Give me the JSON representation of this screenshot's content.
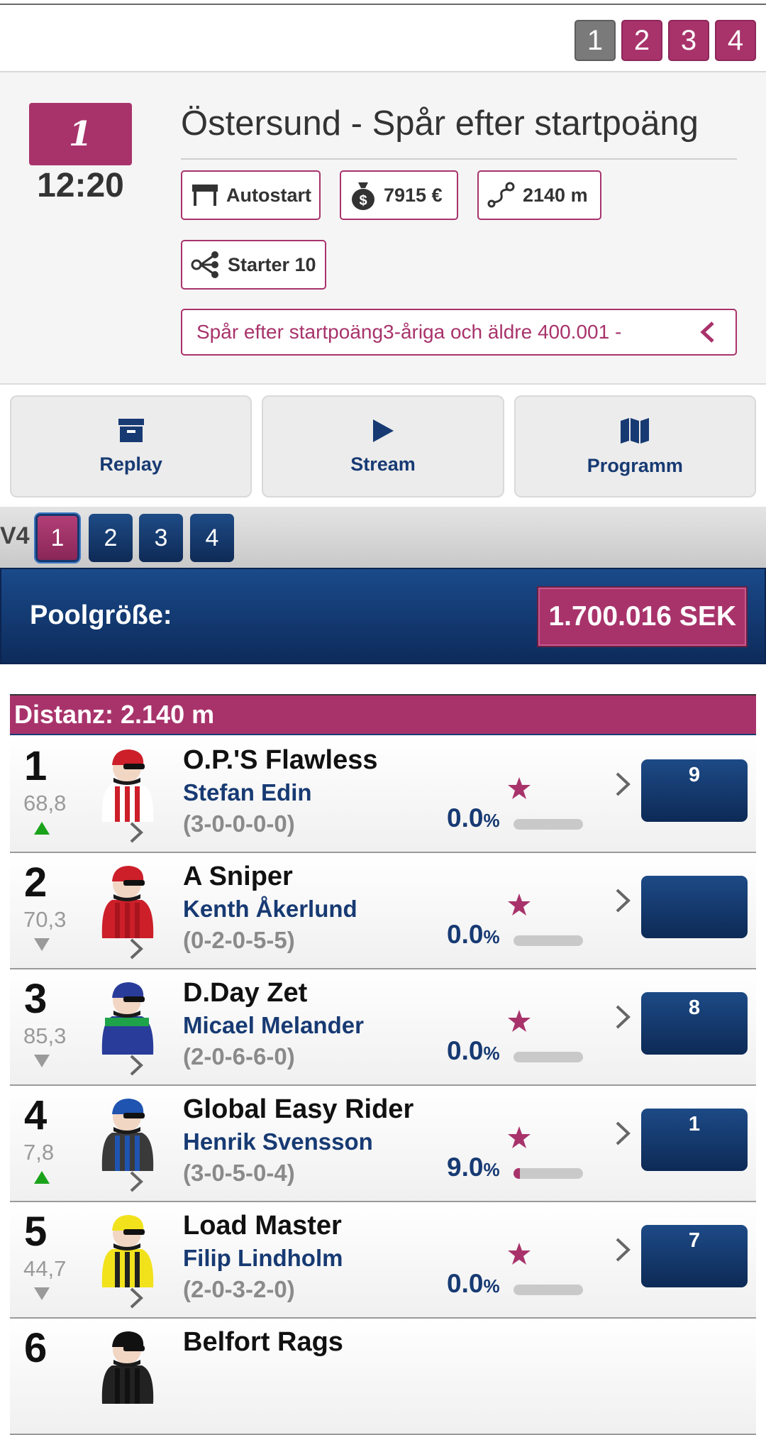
{
  "race_selector": {
    "tabs": [
      "1",
      "2",
      "3",
      "4"
    ],
    "active": "1"
  },
  "race": {
    "number": "1",
    "time": "12:20",
    "title": "Östersund - Spår efter startpoäng",
    "start_type": "Autostart",
    "prize": "7915 €",
    "distance": "2140 m",
    "starters": "Starter 10",
    "description": "Spår efter startpoäng3-åriga och äldre 400.001 -"
  },
  "actions": {
    "replay": "Replay",
    "stream": "Stream",
    "program": "Programm"
  },
  "game": {
    "label": "V4",
    "legs": [
      "1",
      "2",
      "3",
      "4"
    ],
    "active_leg": "1"
  },
  "pool": {
    "label": "Poolgröße:",
    "value": "1.700.016 SEK"
  },
  "distance_header": "Distanz: 2.140 m",
  "colors": {
    "accent": "#a8336b",
    "navy": "#0d2b5b",
    "up": "#1aa31a",
    "down": "#9a9a9a"
  },
  "runners": [
    {
      "num": "1",
      "rating": "68,8",
      "trend": "up",
      "name": "O.P.'S Flawless",
      "driver": "Stefan Edin",
      "record": "(3-0-0-0-0)",
      "pct_value": "0.0",
      "pct_unit": "%",
      "pct": 0.0,
      "slot": "9",
      "silk": "red-white-stripes"
    },
    {
      "num": "2",
      "rating": "70,3",
      "trend": "down",
      "name": "A Sniper",
      "driver": "Kenth Åkerlund",
      "record": "(0-2-0-5-5)",
      "pct_value": "0.0",
      "pct_unit": "%",
      "pct": 0.0,
      "slot": "",
      "silk": "red"
    },
    {
      "num": "3",
      "rating": "85,3",
      "trend": "down",
      "name": "D.Day Zet",
      "driver": "Micael Melander",
      "record": "(2-0-6-6-0)",
      "pct_value": "0.0",
      "pct_unit": "%",
      "pct": 0.0,
      "slot": "8",
      "silk": "blue-green"
    },
    {
      "num": "4",
      "rating": "7,8",
      "trend": "up",
      "name": "Global Easy Rider",
      "driver": "Henrik Svensson",
      "record": "(3-0-5-0-4)",
      "pct_value": "9.0",
      "pct_unit": "%",
      "pct": 9.0,
      "slot": "1",
      "silk": "black-blue-stripes"
    },
    {
      "num": "5",
      "rating": "44,7",
      "trend": "down",
      "name": "Load Master",
      "driver": "Filip Lindholm",
      "record": "(2-0-3-2-0)",
      "pct_value": "0.0",
      "pct_unit": "%",
      "pct": 0.0,
      "slot": "7",
      "silk": "yellow-black-stripes"
    },
    {
      "num": "6",
      "name": "Belfort Rags",
      "silk": "black"
    }
  ]
}
